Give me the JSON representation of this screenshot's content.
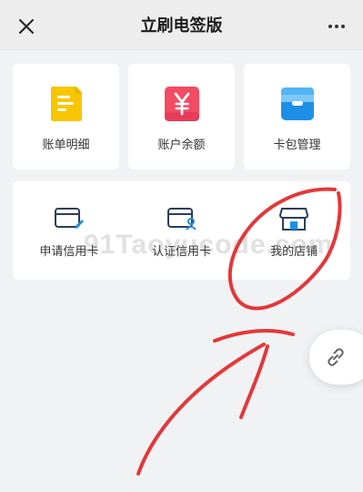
{
  "header": {
    "title": "立刷电签版",
    "close_icon": "close-icon",
    "more_icon": "more-horizontal-icon"
  },
  "quick_cards": [
    {
      "label": "账单明细",
      "icon": "bill-detail-icon",
      "color": "#f7c600"
    },
    {
      "label": "账户余额",
      "icon": "yuan-balance-icon",
      "color": "#f24b63"
    },
    {
      "label": "卡包管理",
      "icon": "card-wallet-icon",
      "color": "#1e8fe6"
    }
  ],
  "services": [
    {
      "label": "申请信用卡",
      "icon": "apply-credit-card-icon"
    },
    {
      "label": "认证信用卡",
      "icon": "verify-credit-card-icon"
    },
    {
      "label": "我的店铺",
      "icon": "my-store-icon"
    }
  ],
  "float_button": {
    "icon": "link-icon"
  },
  "watermark": {
    "text": "91Taoyucode.com"
  },
  "colors": {
    "accent_blue": "#1e8fe6",
    "annotation_red": "#e3383a",
    "icon_dark": "#2c3e5a"
  }
}
